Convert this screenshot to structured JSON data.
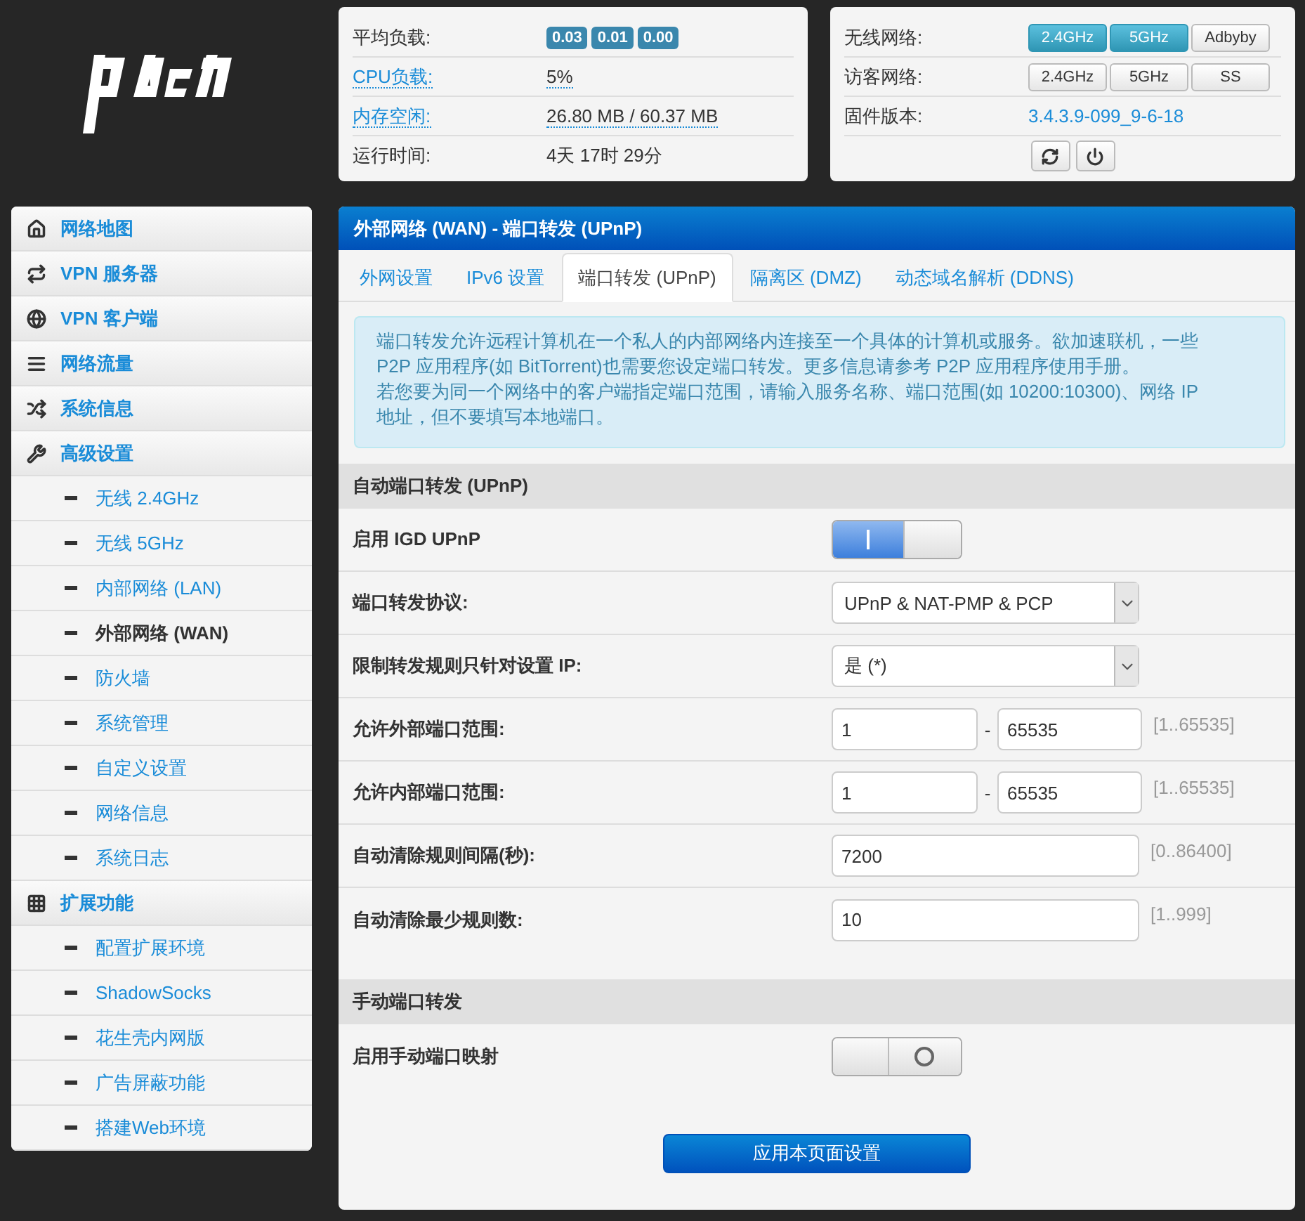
{
  "status": {
    "rows": [
      {
        "label": "平均负载:",
        "link": false,
        "badges": [
          "0.03",
          "0.01",
          "0.00"
        ]
      },
      {
        "label": "CPU负载:",
        "link": true,
        "value": "5%"
      },
      {
        "label": "内存空闲:",
        "link": true,
        "value": "26.80 MB / 60.37 MB"
      },
      {
        "label": "运行时间:",
        "link": false,
        "value": "4天 17时 29分"
      }
    ]
  },
  "wireless": {
    "rows": [
      {
        "label": "无线网络:",
        "buttons": [
          {
            "label": "2.4GHz",
            "selected": true
          },
          {
            "label": "5GHz",
            "selected": true
          },
          {
            "label": "Adbyby",
            "selected": false
          }
        ]
      },
      {
        "label": "访客网络:",
        "buttons": [
          {
            "label": "2.4GHz",
            "selected": false
          },
          {
            "label": "5GHz",
            "selected": false
          },
          {
            "label": "SS",
            "selected": false
          }
        ]
      },
      {
        "label": "固件版本:",
        "value": "3.4.3.9-099_9-6-18"
      }
    ]
  },
  "sidebar": {
    "items": [
      {
        "label": "网络地图",
        "selected": false
      },
      {
        "label": "VPN 服务器",
        "selected": false
      },
      {
        "label": "VPN 客户端",
        "selected": false
      },
      {
        "label": "网络流量",
        "selected": false
      },
      {
        "label": "系统信息",
        "selected": false
      },
      {
        "label": "高级设置",
        "selected": false,
        "children": [
          {
            "label": "无线 2.4GHz",
            "selected": false
          },
          {
            "label": "无线 5GHz",
            "selected": false
          },
          {
            "label": "内部网络 (LAN)",
            "selected": false
          },
          {
            "label": "外部网络 (WAN)",
            "selected": true
          },
          {
            "label": "防火墙",
            "selected": false
          },
          {
            "label": "系统管理",
            "selected": false
          },
          {
            "label": "自定义设置",
            "selected": false
          },
          {
            "label": "网络信息",
            "selected": false
          },
          {
            "label": "系统日志",
            "selected": false
          }
        ]
      },
      {
        "label": "扩展功能",
        "selected": false,
        "children": [
          {
            "label": "配置扩展环境",
            "selected": false
          },
          {
            "label": "ShadowSocks",
            "selected": false
          },
          {
            "label": "花生壳内网版",
            "selected": false
          },
          {
            "label": "广告屏蔽功能",
            "selected": false
          },
          {
            "label": "搭建Web环境",
            "selected": false
          }
        ]
      }
    ]
  },
  "panel": {
    "title": "外部网络 (WAN) - 端口转发 (UPnP)",
    "tabs": [
      {
        "label": "外网设置",
        "selected": false
      },
      {
        "label": "IPv6 设置",
        "selected": false
      },
      {
        "label": "端口转发 (UPnP)",
        "selected": true
      },
      {
        "label": "隔离区 (DMZ)",
        "selected": false
      },
      {
        "label": "动态域名解析 (DDNS)",
        "selected": false
      }
    ],
    "info": [
      "端口转发允许远程计算机在一个私人的内部网络内连接至一个具体的计算机或服务。欲加速联机，一些 P2P 应用程序(如 BitTorrent)也需要您设定端口转发。更多信息请参考 P2P 应用程序使用手册。",
      "若您要为同一个网络中的客户端指定端口范围，请输入服务名称、端口范围(如 10200:10300)、网络 IP 地址，但不要填写本地端口。"
    ],
    "sections": [
      {
        "title": "自动端口转发 (UPnP)",
        "rows": [
          {
            "label": "启用 IGD UPnP",
            "kind": "toggle",
            "on": true
          },
          {
            "label": "端口转发协议:",
            "kind": "select",
            "value": "UPnP & NAT-PMP & PCP"
          },
          {
            "label": "限制转发规则只针对设置 IP:",
            "kind": "select",
            "value": "是 (*)"
          },
          {
            "label": "允许外部端口范围:",
            "kind": "range",
            "from": "1",
            "separator": "-",
            "to": "65535",
            "hint": "[1..65535]"
          },
          {
            "label": "允许内部端口范围:",
            "kind": "range",
            "from": "1",
            "separator": "-",
            "to": "65535",
            "hint": "[1..65535]"
          },
          {
            "label": "自动清除规则间隔(秒):",
            "kind": "input",
            "value": "7200",
            "hint": "[0..86400]"
          },
          {
            "label": "自动清除最少规则数:",
            "kind": "input",
            "value": "10",
            "hint": "[1..999]"
          }
        ]
      },
      {
        "title": "手动端口转发",
        "rows": [
          {
            "label": "启用手动端口映射",
            "kind": "toggle",
            "on": false
          }
        ]
      }
    ],
    "apply": "应用本页面设置"
  }
}
